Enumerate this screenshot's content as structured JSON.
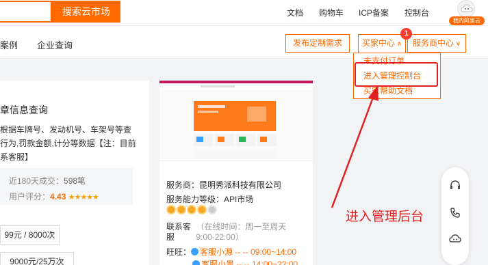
{
  "topbar": {
    "search_button": "搜索云市场",
    "links": [
      "文档",
      "购物车",
      "ICP备案",
      "控制台"
    ],
    "avatar_tag": "我的阿里云"
  },
  "subnav": {
    "case_link": "案例",
    "company_link": "企业查询",
    "publish_button": "发布定制需求",
    "buyer_center": "买家中心",
    "provider_center": "服务商中心",
    "badge_count": "1"
  },
  "dropdown": {
    "items": [
      "未支付订单",
      "进入管理控制台",
      "买家帮助文档"
    ]
  },
  "product": {
    "title": "章信息查询",
    "desc_lines": [
      "根据车牌号、发动机号、车架号等查",
      "行为,罚款金额,计分等数据【注：目前",
      "系客服】"
    ],
    "sales_label": "近180天成交：",
    "sales_value": "598笔",
    "rating_label": "用户评分：",
    "rating_value": "4.43",
    "stars": "★★★★★",
    "price_1": "99元 / 8000次",
    "price_2": "9000元/25万次"
  },
  "provider": {
    "provider_label": "服务商：",
    "provider_name": "昆明秀派科技有限公司",
    "level_label": "服务能力等级：",
    "level_value": "API市场",
    "cs_label_1": "联系客",
    "cs_label_2": "服",
    "cs_hours_1": "（在线时间：周一至周天",
    "cs_hours_2": "9:00-22:00）",
    "ww_label": "旺旺：",
    "ww_1_name": "客服小源",
    "ww_1_time": "-- -- 09:00~14:00",
    "ww_2_name": "客服小景",
    "ww_2_time": "-- -- 14:00~22:00"
  },
  "annotation": {
    "text": "进入管理后台",
    "color": "#e02020"
  },
  "colors": {
    "accent": "#ff6a00",
    "annotation_red": "#e02020"
  }
}
